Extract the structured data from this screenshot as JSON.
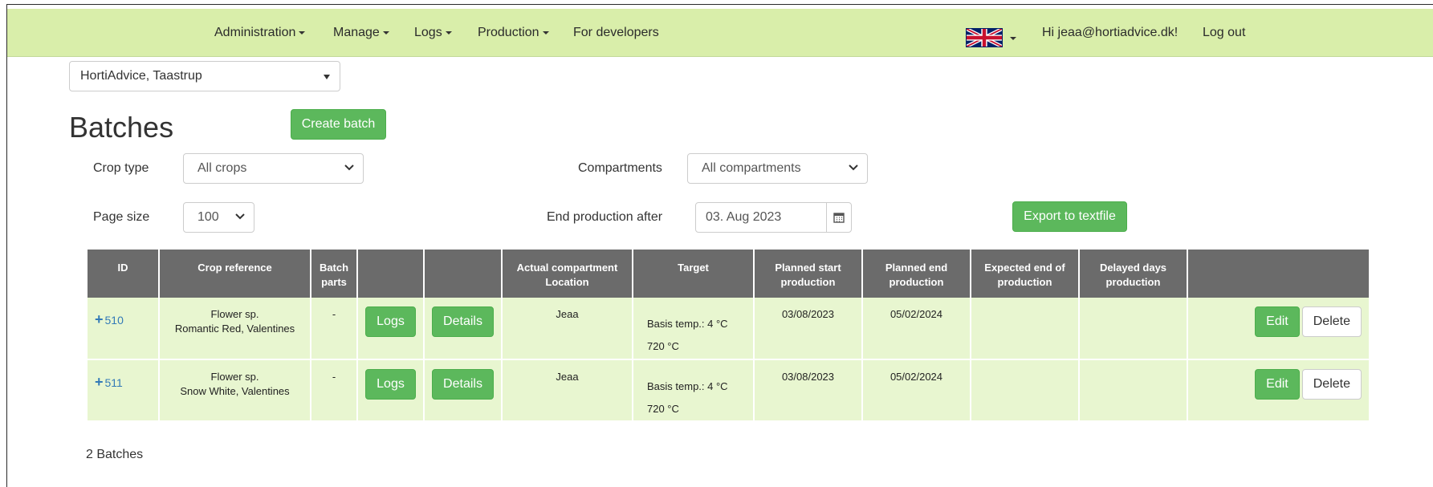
{
  "nav": {
    "administration": "Administration",
    "manage": "Manage",
    "logs": "Logs",
    "production": "Production",
    "developers": "For developers",
    "greeting": "Hi jeaa@hortiadvice.dk!",
    "logout": "Log out",
    "language_icon": "uk-flag-icon"
  },
  "org_select": {
    "value": "HortiAdvice, Taastrup"
  },
  "page": {
    "title": "Batches",
    "create_button": "Create batch"
  },
  "filters": {
    "crop_type_label": "Crop type",
    "crop_type_value": "All crops",
    "compartments_label": "Compartments",
    "compartments_value": "All compartments",
    "page_size_label": "Page size",
    "page_size_value": "100",
    "end_production_label": "End production after",
    "end_production_value": "03. Aug 2023",
    "export_button": "Export to textfile"
  },
  "table": {
    "headers": {
      "id": "ID",
      "crop_reference": "Crop reference",
      "batch_parts": "Batch parts",
      "logs": "",
      "details": "",
      "compartment": "Actual compartment Location",
      "target": "Target",
      "planned_start": "Planned start production",
      "planned_end": "Planned end production",
      "expected_end": "Expected end of production",
      "delayed_days": "Delayed days production",
      "actions": ""
    },
    "rows": [
      {
        "id": "510",
        "crop_line1": "Flower sp.",
        "crop_line2": "Romantic Red, Valentines",
        "batch_parts": "-",
        "logs_label": "Logs",
        "details_label": "Details",
        "compartment": "Jeaa",
        "target_line1": "Basis temp.: 4 °C",
        "target_line2": "720 °C",
        "planned_start": "03/08/2023",
        "planned_end": "05/02/2024",
        "expected_end": "",
        "delayed_days": "",
        "edit_label": "Edit",
        "delete_label": "Delete"
      },
      {
        "id": "511",
        "crop_line1": "Flower sp.",
        "crop_line2": "Snow White, Valentines",
        "batch_parts": "-",
        "logs_label": "Logs",
        "details_label": "Details",
        "compartment": "Jeaa",
        "target_line1": "Basis temp.: 4 °C",
        "target_line2": "720 °C",
        "planned_start": "03/08/2023",
        "planned_end": "05/02/2024",
        "expected_end": "",
        "delayed_days": "",
        "edit_label": "Edit",
        "delete_label": "Delete"
      }
    ]
  },
  "footer": {
    "count": "2 Batches"
  },
  "colors": {
    "navbar": "#d9eeaa",
    "success": "#5cb85c",
    "table_header": "#6b6b6b",
    "row_bg": "#e8f6d0",
    "link": "#337ab7"
  }
}
